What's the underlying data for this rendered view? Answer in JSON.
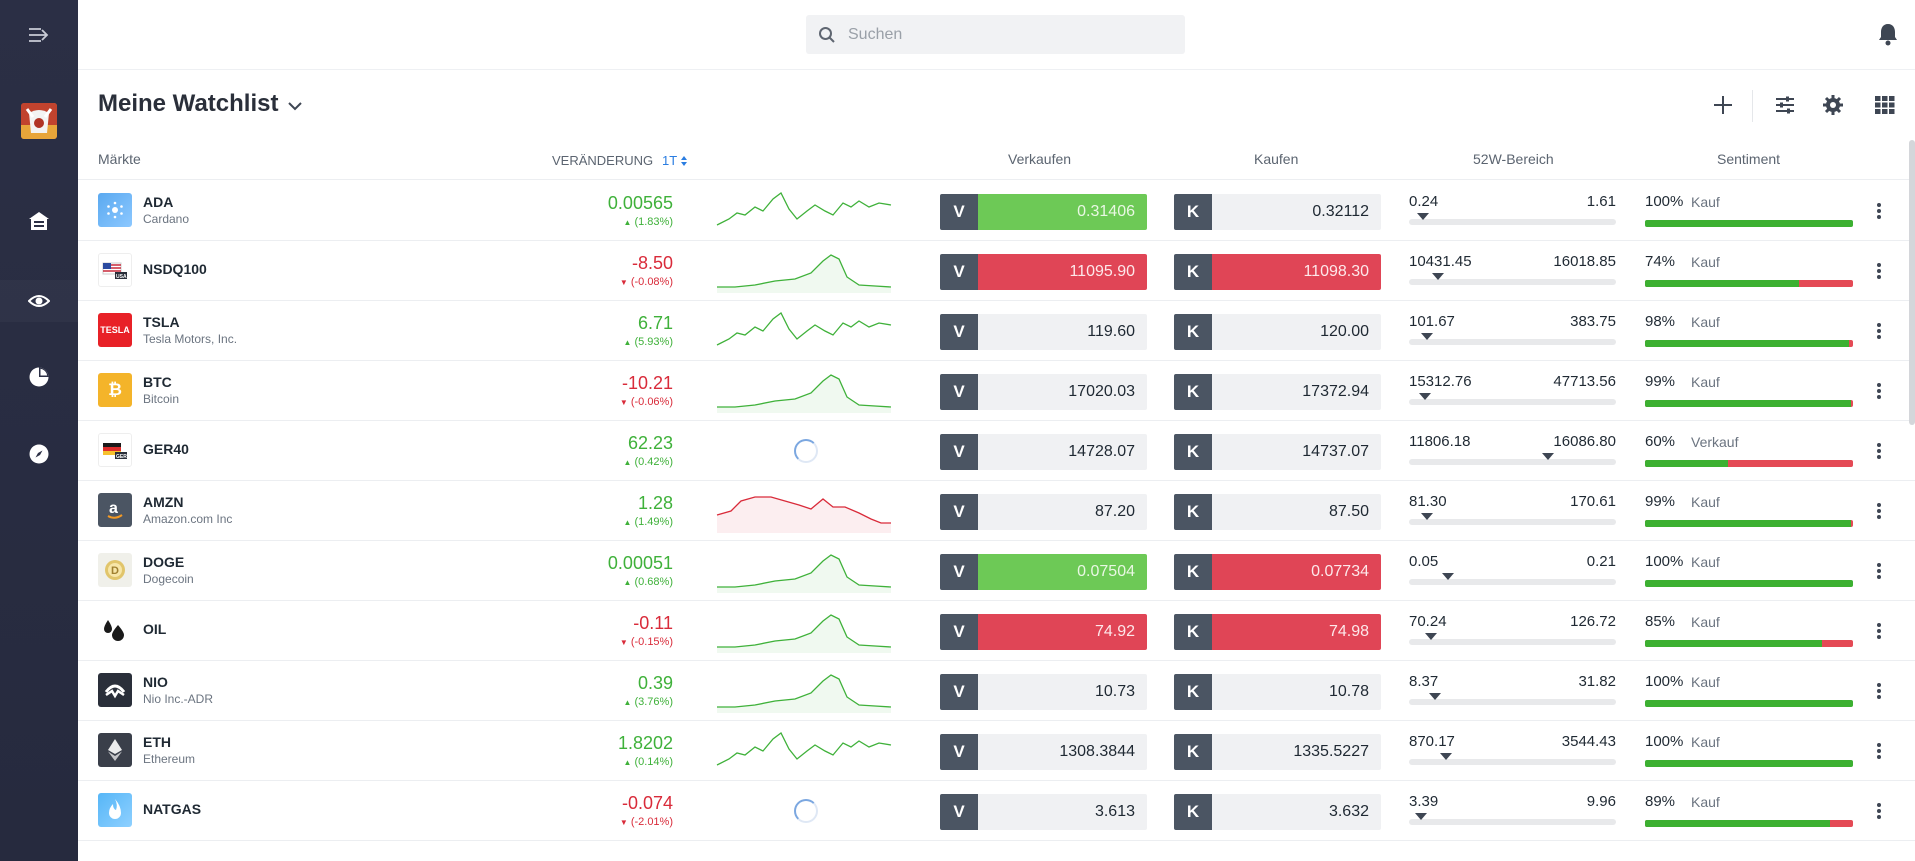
{
  "search": {
    "placeholder": "Suchen"
  },
  "header": {
    "title": "Meine Watchlist"
  },
  "columns": {
    "markets": "Märkte",
    "change": "VERÄNDERUNG",
    "period": "1T",
    "sell": "Verkaufen",
    "buy": "Kaufen",
    "range": "52W-Bereich",
    "sentiment": "Sentiment"
  },
  "colors": {
    "positive": "#3fb13a",
    "negative": "#d92b3a",
    "sell_up": "#6dc956",
    "buy_down": "#e04556",
    "sidebar": "#2b2f45"
  },
  "rows": [
    {
      "symbol": "ADA",
      "name": "Cardano",
      "logo": "cardano-icon",
      "change": "0.00565",
      "change_pct": "(1.83%)",
      "dir": "up",
      "spark": "line-green",
      "sell_label": "V",
      "sell": "0.31406",
      "sell_state": "up",
      "buy_label": "K",
      "buy": "0.32112",
      "buy_state": "neutral",
      "range_low": "0.24",
      "range_high": "1.61",
      "range_pos": 0.04,
      "sentiment_pct": "100%",
      "sentiment_word": "Kauf",
      "sentiment_fill": 1.0
    },
    {
      "symbol": "NSDQ100",
      "name": "",
      "logo": "usa-flag-icon",
      "change": "-8.50",
      "change_pct": "(-0.08%)",
      "dir": "down",
      "spark": "area-green",
      "sell_label": "V",
      "sell": "11095.90",
      "sell_state": "down",
      "buy_label": "K",
      "buy": "11098.30",
      "buy_state": "down",
      "range_low": "10431.45",
      "range_high": "16018.85",
      "range_pos": 0.12,
      "sentiment_pct": "74%",
      "sentiment_word": "Kauf",
      "sentiment_fill": 0.74
    },
    {
      "symbol": "TSLA",
      "name": "Tesla Motors, Inc.",
      "logo": "tesla-icon",
      "logo_text": "TESLA",
      "change": "6.71",
      "change_pct": "(5.93%)",
      "dir": "up",
      "spark": "line-green",
      "sell_label": "V",
      "sell": "119.60",
      "sell_state": "neutral",
      "buy_label": "K",
      "buy": "120.00",
      "buy_state": "neutral",
      "range_low": "101.67",
      "range_high": "383.75",
      "range_pos": 0.06,
      "sentiment_pct": "98%",
      "sentiment_word": "Kauf",
      "sentiment_fill": 0.98
    },
    {
      "symbol": "BTC",
      "name": "Bitcoin",
      "logo": "bitcoin-icon",
      "change": "-10.21",
      "change_pct": "(-0.06%)",
      "dir": "down",
      "spark": "area-green",
      "sell_label": "V",
      "sell": "17020.03",
      "sell_state": "neutral",
      "buy_label": "K",
      "buy": "17372.94",
      "buy_state": "neutral",
      "range_low": "15312.76",
      "range_high": "47713.56",
      "range_pos": 0.05,
      "sentiment_pct": "99%",
      "sentiment_word": "Kauf",
      "sentiment_fill": 0.99
    },
    {
      "symbol": "GER40",
      "name": "",
      "logo": "germany-flag-icon",
      "change": "62.23",
      "change_pct": "(0.42%)",
      "dir": "up",
      "spark": "loading",
      "sell_label": "V",
      "sell": "14728.07",
      "sell_state": "neutral",
      "buy_label": "K",
      "buy": "14737.07",
      "buy_state": "neutral",
      "range_low": "11806.18",
      "range_high": "16086.80",
      "range_pos": 0.68,
      "sentiment_pct": "60%",
      "sentiment_word": "Verkauf",
      "sentiment_fill": 0.4
    },
    {
      "symbol": "AMZN",
      "name": "Amazon.com Inc",
      "logo": "amazon-icon",
      "change": "1.28",
      "change_pct": "(1.49%)",
      "dir": "up",
      "spark": "area-red",
      "sell_label": "V",
      "sell": "87.20",
      "sell_state": "neutral",
      "buy_label": "K",
      "buy": "87.50",
      "buy_state": "neutral",
      "range_low": "81.30",
      "range_high": "170.61",
      "range_pos": 0.06,
      "sentiment_pct": "99%",
      "sentiment_word": "Kauf",
      "sentiment_fill": 0.99
    },
    {
      "symbol": "DOGE",
      "name": "Dogecoin",
      "logo": "dogecoin-icon",
      "change": "0.00051",
      "change_pct": "(0.68%)",
      "dir": "up",
      "spark": "area-green",
      "sell_label": "V",
      "sell": "0.07504",
      "sell_state": "up",
      "buy_label": "K",
      "buy": "0.07734",
      "buy_state": "down",
      "range_low": "0.05",
      "range_high": "0.21",
      "range_pos": 0.17,
      "sentiment_pct": "100%",
      "sentiment_word": "Kauf",
      "sentiment_fill": 1.0
    },
    {
      "symbol": "OIL",
      "name": "",
      "logo": "oil-drop-icon",
      "change": "-0.11",
      "change_pct": "(-0.15%)",
      "dir": "down",
      "spark": "area-green",
      "sell_label": "V",
      "sell": "74.92",
      "sell_state": "down",
      "buy_label": "K",
      "buy": "74.98",
      "buy_state": "down",
      "range_low": "70.24",
      "range_high": "126.72",
      "range_pos": 0.08,
      "sentiment_pct": "85%",
      "sentiment_word": "Kauf",
      "sentiment_fill": 0.85
    },
    {
      "symbol": "NIO",
      "name": "Nio Inc.-ADR",
      "logo": "nio-icon",
      "change": "0.39",
      "change_pct": "(3.76%)",
      "dir": "up",
      "spark": "area-green",
      "sell_label": "V",
      "sell": "10.73",
      "sell_state": "neutral",
      "buy_label": "K",
      "buy": "10.78",
      "buy_state": "neutral",
      "range_low": "8.37",
      "range_high": "31.82",
      "range_pos": 0.1,
      "sentiment_pct": "100%",
      "sentiment_word": "Kauf",
      "sentiment_fill": 1.0
    },
    {
      "symbol": "ETH",
      "name": "Ethereum",
      "logo": "ethereum-icon",
      "change": "1.8202",
      "change_pct": "(0.14%)",
      "dir": "up",
      "spark": "line-green",
      "sell_label": "V",
      "sell": "1308.3844",
      "sell_state": "neutral",
      "buy_label": "K",
      "buy": "1335.5227",
      "buy_state": "neutral",
      "range_low": "870.17",
      "range_high": "3544.43",
      "range_pos": 0.16,
      "sentiment_pct": "100%",
      "sentiment_word": "Kauf",
      "sentiment_fill": 1.0
    },
    {
      "symbol": "NATGAS",
      "name": "",
      "logo": "flame-icon",
      "change": "-0.074",
      "change_pct": "(-2.01%)",
      "dir": "down",
      "spark": "loading",
      "sell_label": "V",
      "sell": "3.613",
      "sell_state": "neutral",
      "buy_label": "K",
      "buy": "3.632",
      "buy_state": "neutral",
      "range_low": "3.39",
      "range_high": "9.96",
      "range_pos": 0.03,
      "sentiment_pct": "89%",
      "sentiment_word": "Kauf",
      "sentiment_fill": 0.89
    }
  ]
}
